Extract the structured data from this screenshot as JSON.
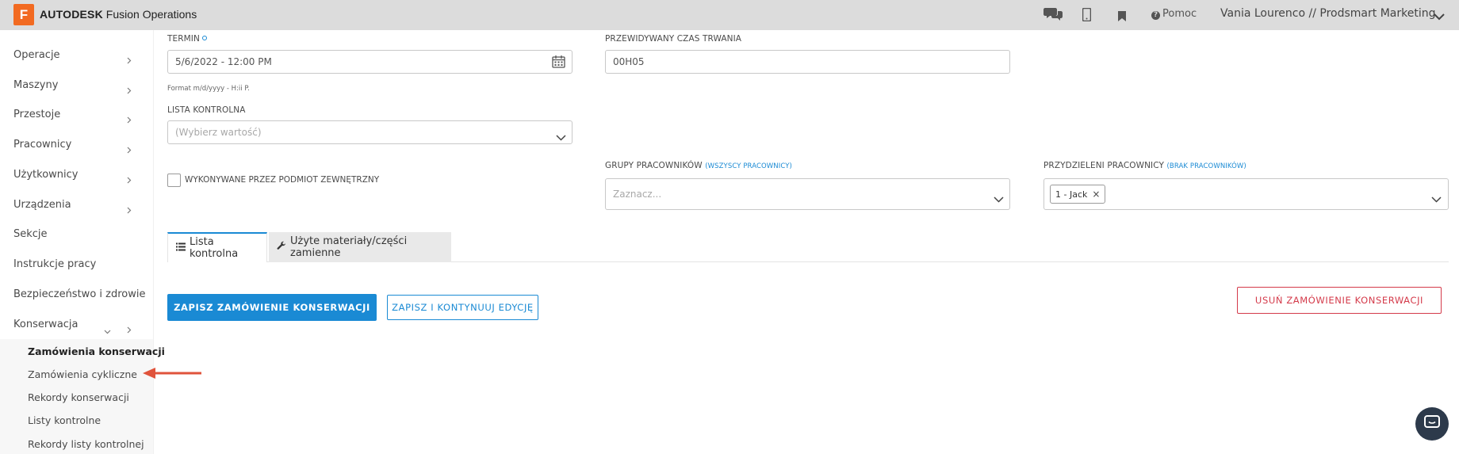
{
  "topbar": {
    "logo_letter": "F",
    "brand_bold": "AUTODESK",
    "brand_rest": "Fusion Operations",
    "help_label": "Pomoc",
    "user_label": "Vania Lourenco // Prodsmart Marketing"
  },
  "sidebar": {
    "items": [
      {
        "label": "Operacje"
      },
      {
        "label": "Maszyny"
      },
      {
        "label": "Przestoje"
      },
      {
        "label": "Pracownicy"
      },
      {
        "label": "Użytkownicy"
      },
      {
        "label": "Urządzenia"
      },
      {
        "label": "Sekcje"
      },
      {
        "label": "Instrukcje pracy"
      },
      {
        "label": "Bezpieczeństwo i zdrowie"
      },
      {
        "label": "Konserwacja"
      }
    ],
    "subitems": [
      {
        "label": "Zamówienia konserwacji",
        "active": true
      },
      {
        "label": "Zamówienia cykliczne"
      },
      {
        "label": "Rekordy konserwacji"
      },
      {
        "label": "Listy kontrolne"
      },
      {
        "label": "Rekordy listy kontrolnej"
      }
    ]
  },
  "form": {
    "termin_label": "TERMIN",
    "termin_value": "5/6/2022 - 12:00 PM",
    "termin_hint": "Format m/d/yyyy - H:ii P.",
    "duration_label": "PRZEWIDYWANY CZAS TRWANIA",
    "duration_value": "00H05",
    "checklist_label": "LISTA KONTROLNA",
    "checklist_placeholder": "(Wybierz wartość)",
    "external_label": "WYKONYWANE PRZEZ PODMIOT ZEWNĘTRZNY",
    "groups_label": "GRUPY PRACOWNIKÓW",
    "groups_link": "(WSZYSCY PRACOWNICY)",
    "groups_placeholder": "Zaznacz...",
    "assigned_label": "PRZYDZIELENI PRACOWNICY",
    "assigned_link": "(BRAK PRACOWNIKÓW)",
    "assigned_chip": "1 - Jack",
    "chip_remove": "×"
  },
  "tabs": [
    {
      "label": "Lista kontrolna",
      "active": true
    },
    {
      "label": "Użyte materiały/części zamienne"
    }
  ],
  "actions": {
    "save": "ZAPISZ ZAMÓWIENIE KONSERWACJI",
    "save_continue": "ZAPISZ I KONTYNUUJ EDYCJĘ",
    "delete": "USUŃ ZAMÓWIENIE KONSERWACJI"
  },
  "colors": {
    "accent": "#1a8ad4",
    "danger": "#d43a4a",
    "logo": "#f26a21",
    "annotation_arrow": "#e0533b"
  }
}
